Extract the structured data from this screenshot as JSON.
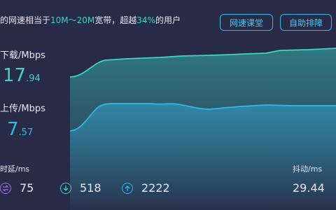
{
  "summary": {
    "prefix": "的网速相当于",
    "range": "10M～20M",
    "middle": "宽带，超越",
    "percent": "34%",
    "suffix": "的用户"
  },
  "buttons": {
    "course": "网速课堂",
    "diagnose": "自助排障"
  },
  "download": {
    "label": "下载/Mbps",
    "int": "17",
    "dec": ".94",
    "color": "#3ad6c6"
  },
  "upload": {
    "label": "上传/Mbps",
    "int": "7",
    "dec": ".57",
    "color": "#35b6ea"
  },
  "latency": {
    "label": "时延/ms",
    "values": [
      "75",
      "518",
      "2222"
    ],
    "icons": [
      "swap-icon",
      "arrow-down-circle-icon",
      "arrow-up-circle-icon"
    ],
    "colors": [
      "#a36bf0",
      "#3ad6c6",
      "#35b6ea"
    ]
  },
  "jitter": {
    "label": "抖动/ms",
    "value": "29.44"
  },
  "colors": {
    "background": "#282b45",
    "accent_green": "#3ad6c6",
    "accent_blue": "#35b6ea"
  }
}
